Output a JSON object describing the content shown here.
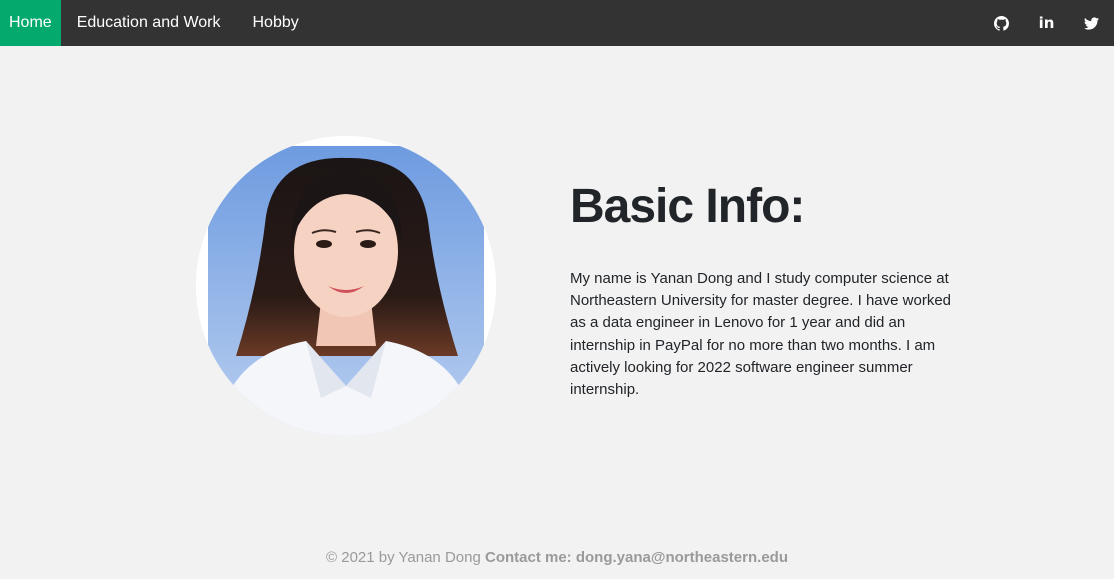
{
  "nav": {
    "items": [
      {
        "label": "Home",
        "active": true
      },
      {
        "label": "Education and Work",
        "active": false
      },
      {
        "label": "Hobby",
        "active": false
      }
    ],
    "icons": [
      "github-icon",
      "linkedin-icon",
      "twitter-icon"
    ],
    "linkedin_text": "in",
    "active_color": "#04aa6d",
    "bar_color": "#333333"
  },
  "main": {
    "heading": "Basic Info:",
    "paragraph": "My name is Yanan Dong and I study computer science at Northeastern University for master degree. I have worked as a data engineer in Lenovo for 1 year and did an internship in PayPal for no more than two months. I am actively looking for 2022 software engineer summer internship.",
    "photo_icon": "profile-photo"
  },
  "footer": {
    "copyright": "© 2021 by Yanan Dong",
    "contact": "Contact me: dong.yana@northeastern.edu"
  }
}
